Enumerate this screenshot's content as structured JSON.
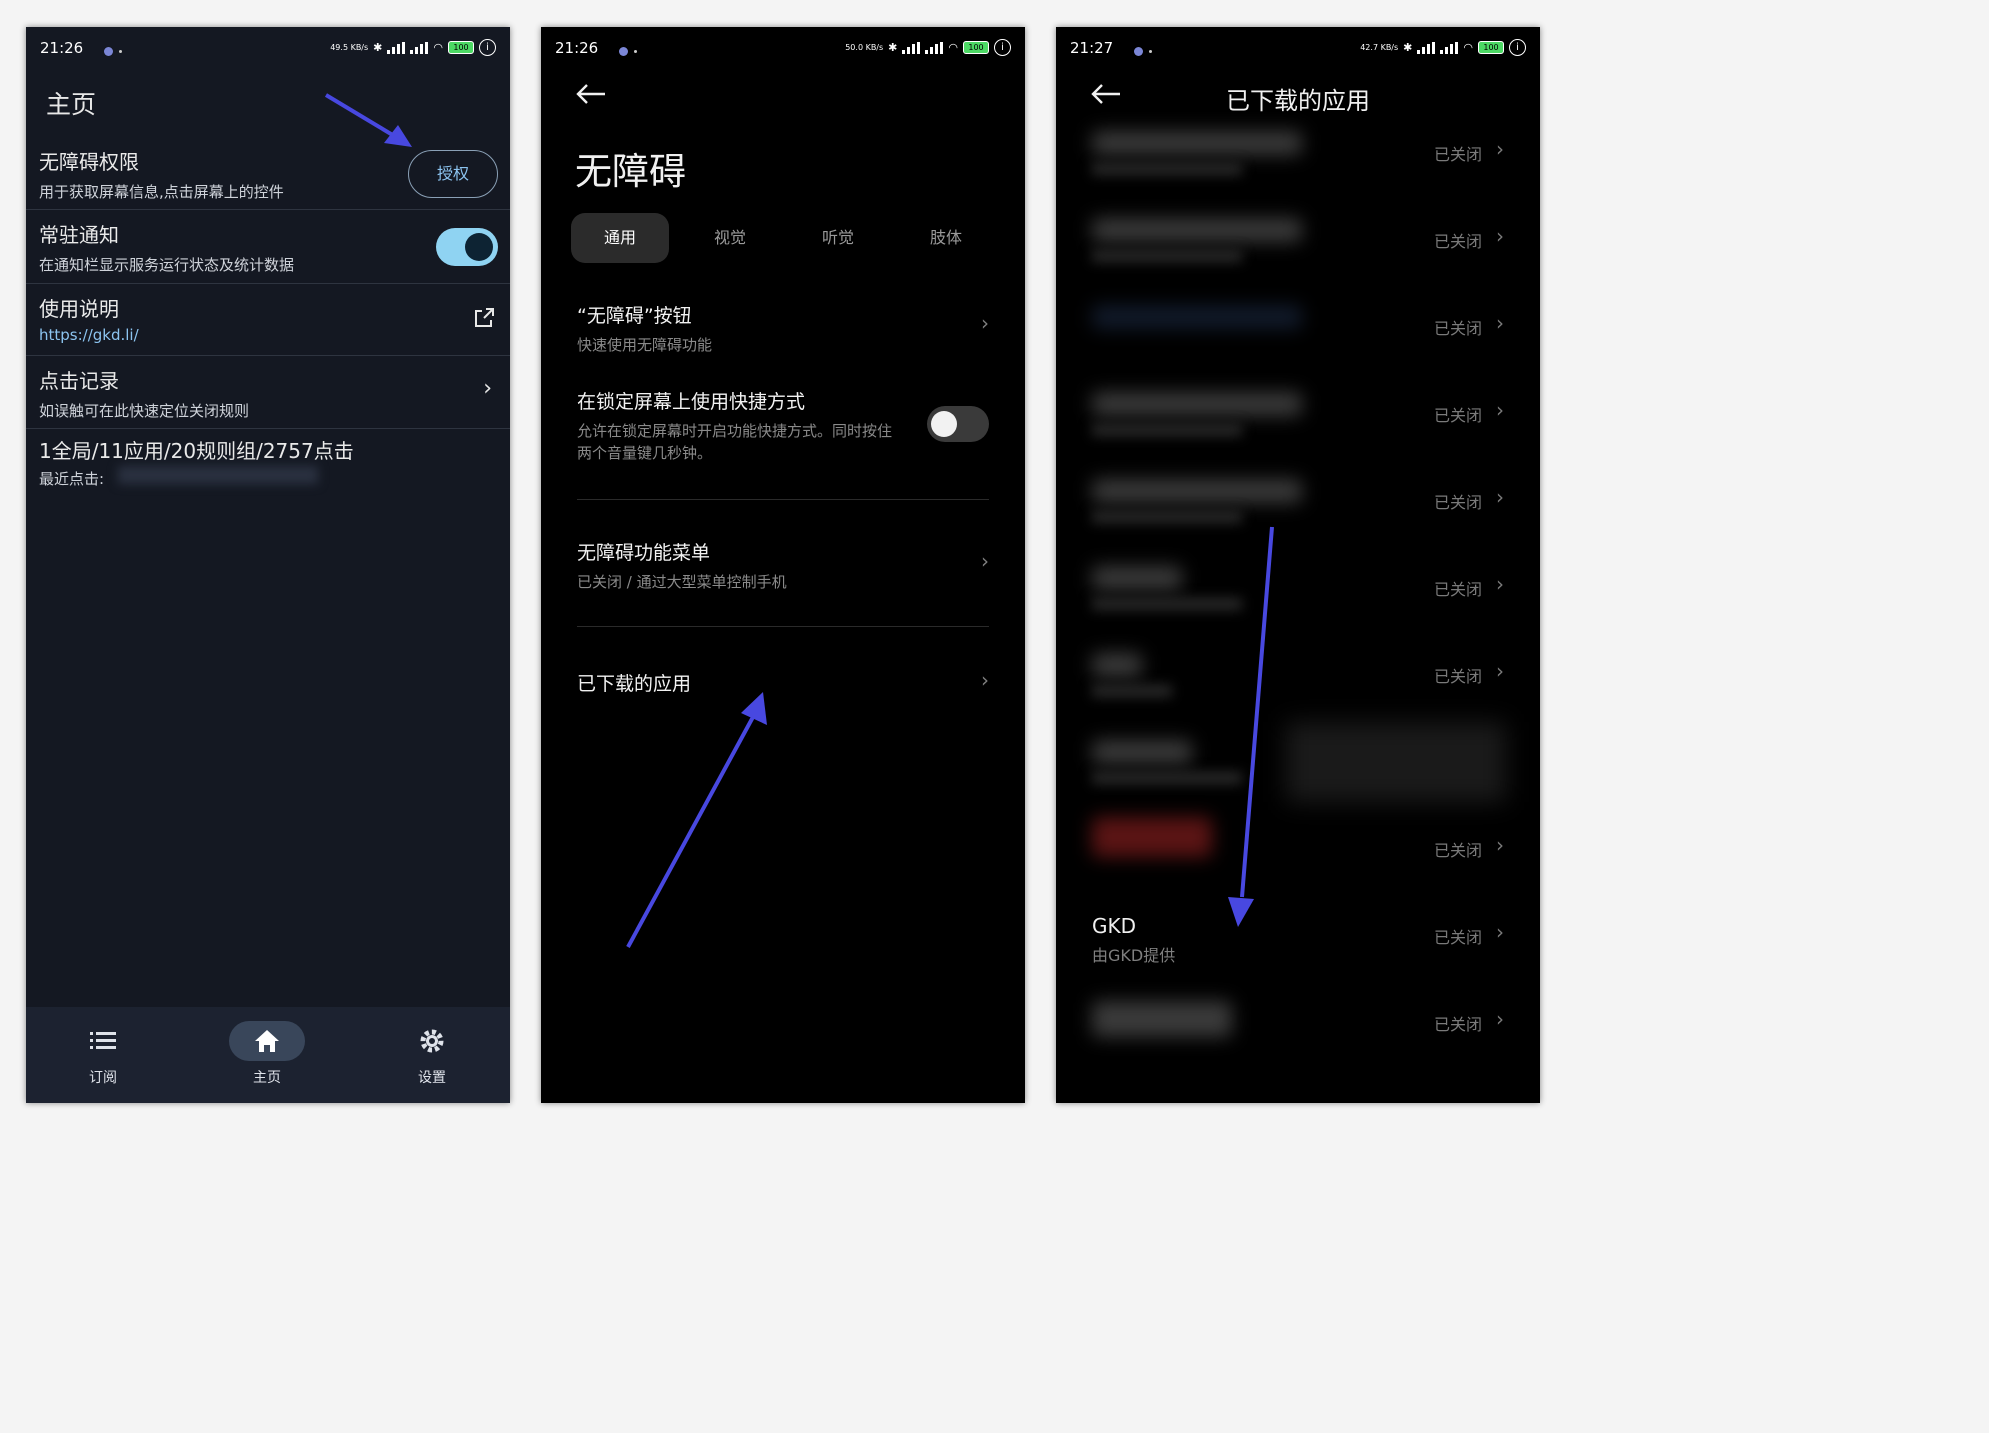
{
  "colors": {
    "accent_arrow": "#4848e0",
    "toggle_on": "#8fd3f2",
    "link": "#8cc4f0"
  },
  "phone1": {
    "status": {
      "time": "21:26",
      "speed": "49.5 KB/s",
      "battery": "100"
    },
    "title": "主页",
    "accessibility": {
      "title": "无障碍权限",
      "desc": "用于获取屏幕信息,点击屏幕上的控件",
      "button": "授权"
    },
    "notify": {
      "title": "常驻通知",
      "desc": "在通知栏显示服务运行状态及统计数据",
      "enabled": true
    },
    "manual": {
      "title": "使用说明",
      "link": "https://gkd.li/"
    },
    "clicklog": {
      "title": "点击记录",
      "desc": "如误触可在此快速定位关闭规则"
    },
    "stats": {
      "title": "1全局/11应用/20规则组/2757点击",
      "recent": "最近点击:"
    },
    "nav": [
      {
        "label": "订阅",
        "icon": "list-icon"
      },
      {
        "label": "主页",
        "icon": "home-icon",
        "active": true
      },
      {
        "label": "设置",
        "icon": "gear-icon"
      }
    ]
  },
  "phone2": {
    "status": {
      "time": "21:26",
      "speed": "50.0 KB/s",
      "battery": "100"
    },
    "title": "无障碍",
    "tabs": [
      "通用",
      "视觉",
      "听觉",
      "肢体"
    ],
    "items": {
      "button": {
        "title": "“无障碍”按钮",
        "desc": "快速使用无障碍功能"
      },
      "lock": {
        "title": "在锁定屏幕上使用快捷方式",
        "desc": "允许在锁定屏幕时开启功能快捷方式。同时按住两个音量键几秒钟。",
        "enabled": false
      },
      "menu": {
        "title": "无障碍功能菜单",
        "desc": "已关闭 / 通过大型菜单控制手机"
      },
      "downloaded": {
        "title": "已下载的应用"
      }
    }
  },
  "phone3": {
    "status": {
      "time": "21:27",
      "speed": "42.7 KB/s",
      "battery": "100"
    },
    "title": "已下载的应用",
    "status_label": "已关闭",
    "gkd": {
      "name": "GKD",
      "provider": "由GKD提供",
      "status": "已关闭"
    }
  }
}
